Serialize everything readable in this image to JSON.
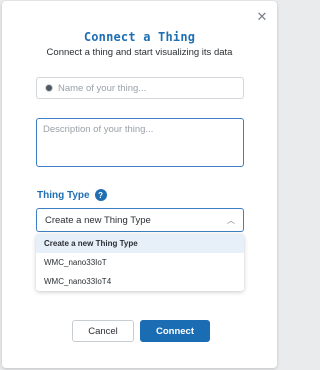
{
  "modal": {
    "title": "Connect a Thing",
    "subtitle": "Connect a thing and start visualizing its data",
    "close_icon": "close-icon"
  },
  "name_field": {
    "placeholder": "Name of your thing...",
    "value": ""
  },
  "description_field": {
    "placeholder": "Description of your thing...",
    "value": ""
  },
  "thing_type": {
    "label": "Thing Type",
    "help_icon_text": "?",
    "selected": "Create a new Thing Type",
    "options": [
      "Create a new Thing Type",
      "WMC_nano33IoT",
      "WMC_nano33IoT4"
    ]
  },
  "buttons": {
    "cancel": "Cancel",
    "connect": "Connect"
  },
  "colors": {
    "accent": "#1f6fb2",
    "primary_button": "#1b6db3",
    "selected_option_bg": "#e7f0f9"
  }
}
